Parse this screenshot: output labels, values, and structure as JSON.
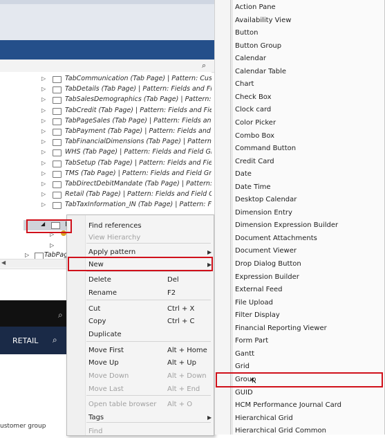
{
  "tree": {
    "rows": [
      "TabCommunication (Tab Page) | Pattern: Custo",
      "TabDetails (Tab Page) | Pattern: Fields and Fiel",
      "TabSalesDemographics (Tab Page) | Pattern: Fiel",
      "TabCredit (Tab Page) | Pattern: Fields and Field",
      "TabPageSales (Tab Page) | Pattern: Fields and",
      "TabPayment (Tab Page) | Pattern: Fields and Fi",
      "TabFinancialDimensions (Tab Page) | Pattern: I",
      "WHS (Tab Page) | Pattern: Fields and Field Grou",
      "TabSetup (Tab Page) | Pattern: Fields and Field",
      "TMS (Tab Page) | Pattern: Fields and Field Grou",
      "TabDirectDebitMandate (Tab Page) | Pattern: T",
      "Retail (Tab Page) | Pattern: Fields and Field Gro",
      "TabTaxInformation_IN (Tab Page) | Pattern: Fie"
    ],
    "selected_label": "I",
    "partial_row": "TabPag"
  },
  "background": {
    "retail_label": "RETAIL",
    "status_text": "ustomer group"
  },
  "context_menu": {
    "items": [
      {
        "label": "Find references",
        "shortcut": "",
        "disabled": false,
        "submenu": false
      },
      {
        "label": "View Hierarchy",
        "shortcut": "",
        "disabled": true,
        "submenu": false
      },
      {
        "label": "Apply pattern",
        "shortcut": "",
        "disabled": false,
        "submenu": true
      },
      {
        "label": "New",
        "shortcut": "",
        "disabled": false,
        "submenu": true
      },
      {
        "label": "Delete",
        "shortcut": "Del",
        "disabled": false,
        "submenu": false
      },
      {
        "label": "Rename",
        "shortcut": "F2",
        "disabled": false,
        "submenu": false
      },
      {
        "label": "Cut",
        "shortcut": "Ctrl + X",
        "disabled": false,
        "submenu": false
      },
      {
        "label": "Copy",
        "shortcut": "Ctrl + C",
        "disabled": false,
        "submenu": false
      },
      {
        "label": "Duplicate",
        "shortcut": "",
        "disabled": false,
        "submenu": false
      },
      {
        "label": "Move First",
        "shortcut": "Alt + Home",
        "disabled": false,
        "submenu": false
      },
      {
        "label": "Move Up",
        "shortcut": "Alt + Up",
        "disabled": false,
        "submenu": false
      },
      {
        "label": "Move Down",
        "shortcut": "Alt + Down",
        "disabled": true,
        "submenu": false
      },
      {
        "label": "Move Last",
        "shortcut": "Alt + End",
        "disabled": true,
        "submenu": false
      },
      {
        "label": "Open table browser",
        "shortcut": "Alt + O",
        "disabled": true,
        "submenu": false
      },
      {
        "label": "Tags",
        "shortcut": "",
        "disabled": false,
        "submenu": true
      },
      {
        "label": "Find",
        "shortcut": "",
        "disabled": true,
        "submenu": false
      }
    ]
  },
  "new_submenu": {
    "items": [
      "Action Pane",
      "Availability View",
      "Button",
      "Button Group",
      "Calendar",
      "Calendar Table",
      "Chart",
      "Check Box",
      "Clock card",
      "Color Picker",
      "Combo Box",
      "Command Button",
      "Credit Card",
      "Date",
      "Date Time",
      "Desktop Calendar",
      "Dimension Entry",
      "Dimension Expression Builder",
      "Document Attachments",
      "Document Viewer",
      "Drop Dialog Button",
      "Expression Builder",
      "External Feed",
      "File Upload",
      "Filter Display",
      "Financial Reporting Viewer",
      "Form Part",
      "Gantt",
      "Grid",
      "Group",
      "GUID",
      "HCM Performance Journal Card",
      "Hierarchical Grid",
      "Hierarchical Grid Common"
    ],
    "highlighted": "Group"
  },
  "colors": {
    "highlight_box": "#d0101a",
    "nav_bar": "#1a2a47"
  }
}
